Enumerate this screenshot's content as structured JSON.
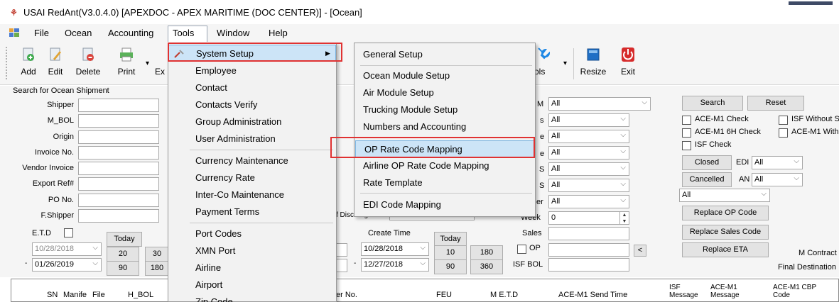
{
  "window": {
    "title": "USAI RedAnt(V3.0.4.0) [APEXDOC - APEX MARITIME (DOC CENTER)] - [Ocean]"
  },
  "menubar": {
    "items": [
      "File",
      "Ocean",
      "Accounting",
      "Tools",
      "Window",
      "Help"
    ]
  },
  "toolbar": {
    "add": "Add",
    "edit": "Edit",
    "delete": "Delete",
    "print": "Print",
    "export_partial": "Ex",
    "tools_partial": "ols",
    "resize": "Resize",
    "exit": "Exit"
  },
  "search": {
    "group_title": "Search for Ocean Shipment",
    "fields": [
      "Shipper",
      "M_BOL",
      "Origin",
      "Invoice No.",
      "Vendor Invoice",
      "Export Ref#",
      "PO No.",
      "F.Shipper"
    ],
    "etd_label": "E.T.D",
    "today": "Today",
    "etd_from": "10/28/2018",
    "etd_to": "01/26/2019",
    "quick_20": "20",
    "quick_30": "30",
    "quick_90": "90",
    "quick_180": "180"
  },
  "middle": {
    "discharge_partial": "f Discharge",
    "week_label": "Week",
    "week_value": "0",
    "create_time_label": "Create Time",
    "today": "Today",
    "create_from": "10/28/2018",
    "create_to": "12/27/2018",
    "q10": "10",
    "q180": "180",
    "q90": "90",
    "q360": "360",
    "sales_label": "Sales",
    "op_label": "OP",
    "isf_bol_label": "ISF BOL",
    "partial_labels": [
      "M",
      "s",
      "e",
      "e",
      "S",
      "S",
      "er"
    ],
    "combo_values": [
      "All",
      "All",
      "All",
      "All",
      "All",
      "All",
      "All"
    ],
    "scroll_left": "<"
  },
  "right": {
    "search": "Search",
    "reset": "Reset",
    "ace_m1_check": "ACE-M1 Check",
    "isf_without": "ISF Without S",
    "ace_m1_6h": "ACE-M1 6H Check",
    "ace_m1_with": "ACE-M1 With",
    "isf_check": "ISF Check",
    "closed": "Closed",
    "edi_label": "EDI",
    "edi_value": "All",
    "cancelled": "Cancelled",
    "an_label": "AN",
    "an_value": "All",
    "all_value": "All",
    "replace_op": "Replace OP Code",
    "replace_sales": "Replace Sales Code",
    "replace_eta": "Replace ETA",
    "m_contract": "M Contract",
    "final_destination": "Final Destination"
  },
  "grid": {
    "columns": [
      "SN",
      "Manife",
      "File",
      "H_BOL",
      "er No.",
      "FEU",
      "M E.T.D",
      "ACE-M1 Send Time"
    ],
    "isf_message": [
      "ISF",
      "Message"
    ],
    "acem1_message": [
      "ACE-M1",
      "Message"
    ],
    "acem1_cbp": [
      "ACE-M1 CBP",
      "Code"
    ]
  },
  "tools_menu": {
    "items": [
      {
        "label": "System Setup",
        "has_submenu": true,
        "highlighted": true
      },
      {
        "label": "Employee"
      },
      {
        "label": "Contact"
      },
      {
        "label": "Contacts Verify"
      },
      {
        "label": "Group Administration"
      },
      {
        "label": "User Administration"
      },
      {
        "label": "Currency Maintenance"
      },
      {
        "label": "Currency Rate"
      },
      {
        "label": "Inter-Co Maintenance"
      },
      {
        "label": "Payment Terms"
      },
      {
        "label": "Port Codes"
      },
      {
        "label": "XMN Port"
      },
      {
        "label": "Airline"
      },
      {
        "label": "Airport"
      },
      {
        "label": "Zip Code"
      }
    ],
    "submenu_arrow": "▶"
  },
  "system_setup_submenu": {
    "items": [
      {
        "label": "General Setup"
      },
      {
        "label": "Ocean Module Setup"
      },
      {
        "label": "Air Module Setup"
      },
      {
        "label": "Trucking Module Setup"
      },
      {
        "label": "Numbers and Accounting"
      },
      {
        "label": "OP Rate Code Mapping",
        "highlighted": true
      },
      {
        "label": "Airline OP Rate Code Mapping"
      },
      {
        "label": "Rate Template"
      },
      {
        "label": "EDI Code Mapping"
      }
    ]
  },
  "colors": {
    "highlight": "#cce4f7",
    "highlight_border": "#7ab3e0",
    "annotation_red": "#e03232",
    "exit_red": "#d62b2b",
    "resize_blue": "#1f6fc5",
    "tools_blue": "#1e88e5"
  }
}
